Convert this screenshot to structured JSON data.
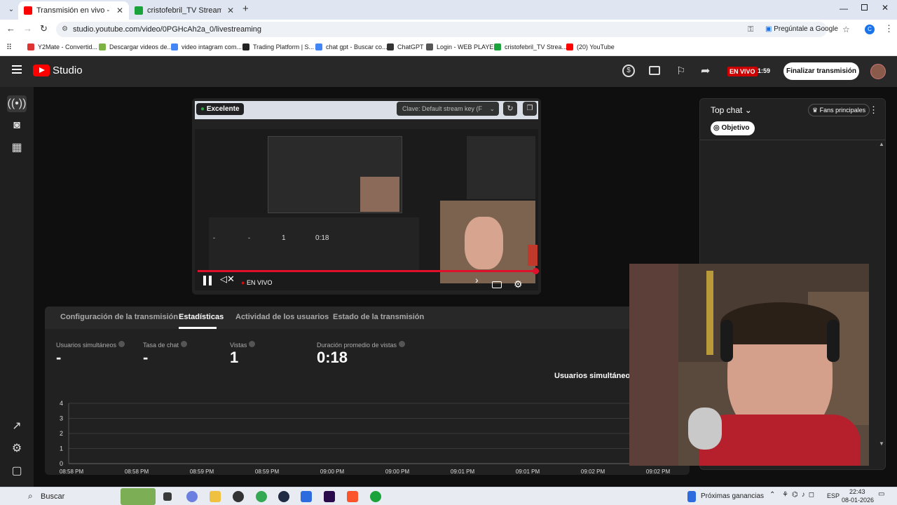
{
  "browser": {
    "tabs": [
      {
        "title": "Transmisión en vivo - YouTube",
        "color": "#ff0000"
      },
      {
        "title": "cristofebril_TV Stream - Watch",
        "color": "#1aa33b"
      }
    ],
    "new_tab": "+",
    "url": "studio.youtube.com/video/0PGHcAh2a_0/livestreaming",
    "ask_google": "Pregúntale a Google",
    "profile_initial": "C",
    "bookmarks": [
      {
        "label": "Y2Mate - Convertid...",
        "color": "#d33"
      },
      {
        "label": "Descargar videos de...",
        "color": "#7cb342"
      },
      {
        "label": "video intagram com...",
        "color": "#4285f4"
      },
      {
        "label": "Trading Platform | S...",
        "color": "#222"
      },
      {
        "label": "chat gpt - Buscar co...",
        "color": "#4285f4"
      },
      {
        "label": "ChatGPT",
        "color": "#333"
      },
      {
        "label": "Login - WEB PLAYER",
        "color": "#555"
      },
      {
        "label": "cristofebril_TV Strea...",
        "color": "#1aa33b"
      },
      {
        "label": "(20) YouTube",
        "color": "#ff0000"
      }
    ]
  },
  "studio": {
    "logo_text": "Studio",
    "live_badge": "EN VIVO",
    "live_time": "1:59",
    "end_button": "Finalizar transmisión"
  },
  "preview": {
    "quality": "Excelente",
    "stream_key": "Clave: Default stream key (F",
    "live_label": "EN VIVO",
    "inner_stats": [
      "-",
      "-",
      "1",
      "0:18"
    ]
  },
  "chat": {
    "title": "Top chat",
    "fans_button": "Fans principales",
    "goal_button": "Objetivo"
  },
  "stats": {
    "tabs": [
      "Configuración de la transmisión",
      "Estadísticas",
      "Actividad de los usuarios",
      "Estado de la transmisión"
    ],
    "active_tab": 1,
    "metrics": [
      {
        "label": "Usuarios simultáneos",
        "value": "-"
      },
      {
        "label": "Tasa de chat",
        "value": "-"
      },
      {
        "label": "Vistas",
        "value": "1"
      },
      {
        "label": "Duración promedio de vistas",
        "value": "0:18"
      }
    ],
    "chart_title": "Usuarios simultáneos"
  },
  "chart_data": {
    "type": "line",
    "title": "Usuarios simultáneos",
    "categories": [
      "08:58 PM",
      "08:58 PM",
      "08:59 PM",
      "08:59 PM",
      "09:00 PM",
      "09:00 PM",
      "09:01 PM",
      "09:01 PM",
      "09:02 PM",
      "09:02 PM"
    ],
    "yticks": [
      0,
      1,
      2,
      3,
      4
    ],
    "ylim": [
      0,
      4
    ],
    "series": [],
    "grid": true
  },
  "taskbar": {
    "search": "Buscar",
    "weather": "Próximas ganancias",
    "lang": "ESP",
    "time": "22:43",
    "date": "08-01-2026"
  }
}
